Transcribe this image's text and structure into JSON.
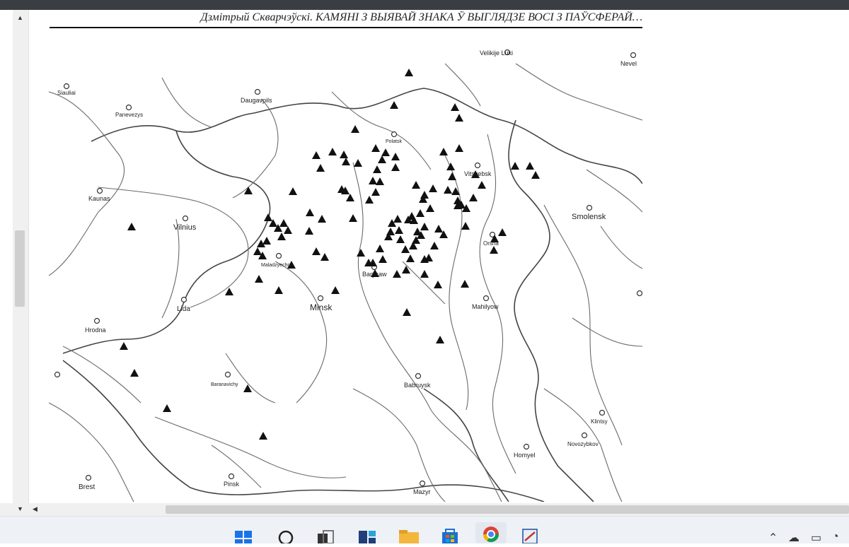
{
  "document": {
    "header": "Дзмітрый Скварчэўскі. КАМЯНІ З ВЫЯВАЙ ЗНАКА Ў ВЫГЛЯДЗЕ ВОСІ З ПАЎСФЕРАЙ…"
  },
  "map": {
    "cities": [
      {
        "name": "Velikije Luki"
      },
      {
        "name": "Nevel"
      },
      {
        "name": "Siauliai"
      },
      {
        "name": "Daugavpils"
      },
      {
        "name": "Panevezys"
      },
      {
        "name": "Polatsk"
      },
      {
        "name": "Vitsyebsk"
      },
      {
        "name": "Kaunas"
      },
      {
        "name": "Vilnius"
      },
      {
        "name": "Smolensk"
      },
      {
        "name": "Orsha"
      },
      {
        "name": "Maladzyechna"
      },
      {
        "name": "Barysaw"
      },
      {
        "name": "Lida"
      },
      {
        "name": "Minsk"
      },
      {
        "name": "Mahilyow"
      },
      {
        "name": "Hrodna"
      },
      {
        "name": "Baranavichy"
      },
      {
        "name": "Babruysk"
      },
      {
        "name": "Klintsy"
      },
      {
        "name": "Novozybkov"
      },
      {
        "name": "Homyel"
      },
      {
        "name": "Brest"
      },
      {
        "name": "Pinsk"
      },
      {
        "name": "Mazyr"
      }
    ]
  },
  "taskbar": {
    "apps": [
      {
        "name": "windows-start"
      },
      {
        "name": "search"
      },
      {
        "name": "task-view"
      },
      {
        "name": "widgets"
      },
      {
        "name": "file-explorer"
      },
      {
        "name": "microsoft-store"
      },
      {
        "name": "chrome"
      },
      {
        "name": "document-viewer"
      }
    ]
  }
}
